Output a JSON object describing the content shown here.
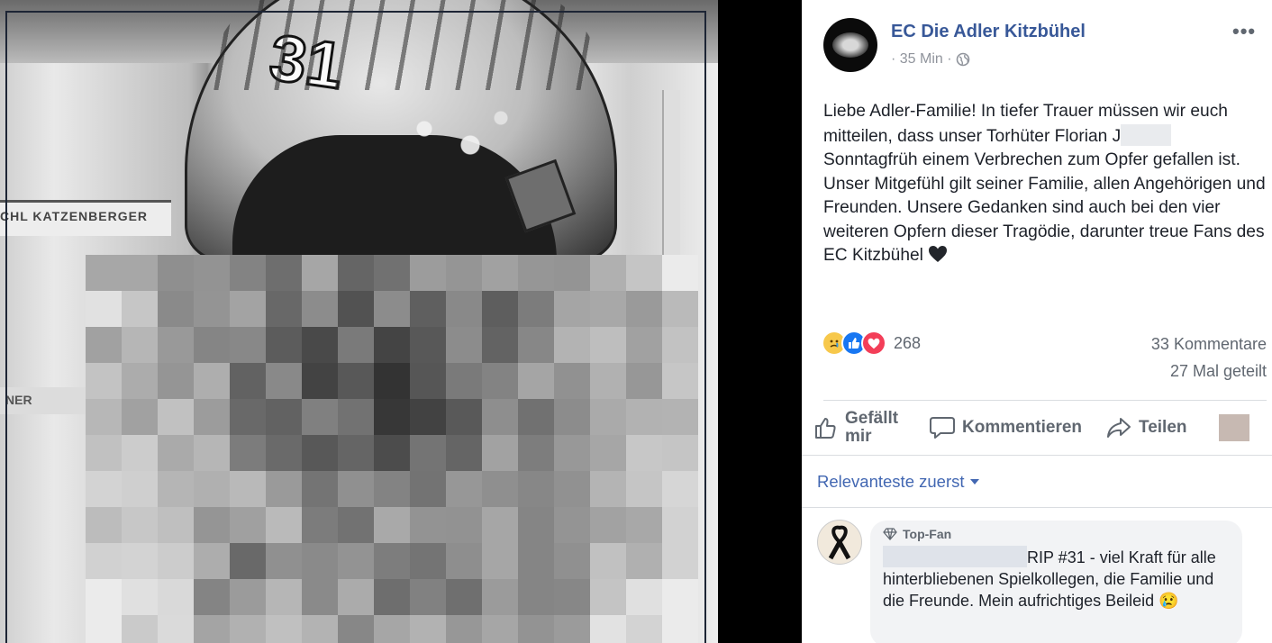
{
  "photo": {
    "helmet_number": "31",
    "banner_text": "CHL KATZENBERGER",
    "ad_text": "NER"
  },
  "post": {
    "page_name": "EC Die Adler Kitzbühel",
    "time": "· 35 Min ·",
    "privacy_icon": "globe-icon",
    "more_icon": "•••",
    "text_part1": "Liebe Adler-Familie! In tiefer Trauer müssen wir euch mitteilen, dass unser Torhüter Florian J",
    "text_part2": " Sonntagfrüh einem Verbrechen zum Opfer gefallen ist. Unser Mitgefühl gilt seiner Familie, allen Angehörigen und Freunden. Unsere Gedanken sind auch bei den vier weiteren Opfern dieser Tragödie, darunter treue Fans des EC Kitzbühel",
    "trailing_emoji": "black-heart"
  },
  "stats": {
    "reaction_count": "268",
    "comments": "33 Kommentare",
    "shares": "27 Mal geteilt"
  },
  "actions": {
    "like": "Gefällt mir",
    "comment": "Kommentieren",
    "share": "Teilen"
  },
  "comments": {
    "sort_label": "Relevanteste zuerst",
    "items": [
      {
        "badge": "Top-Fan",
        "text": "RIP #31 - viel Kraft für alle hinterbliebenen Spielkollegen, die Familie und die Freunde. Mein aufrichtiges Beileid",
        "emoji": "😢"
      }
    ]
  },
  "colors": {
    "link_blue": "#385898",
    "sort_blue": "#4267b2",
    "text": "#1d2129",
    "muted": "#606770",
    "like_blue": "#1877f2",
    "love_red": "#f33e58",
    "sad_yellow": "#f7c84b"
  }
}
